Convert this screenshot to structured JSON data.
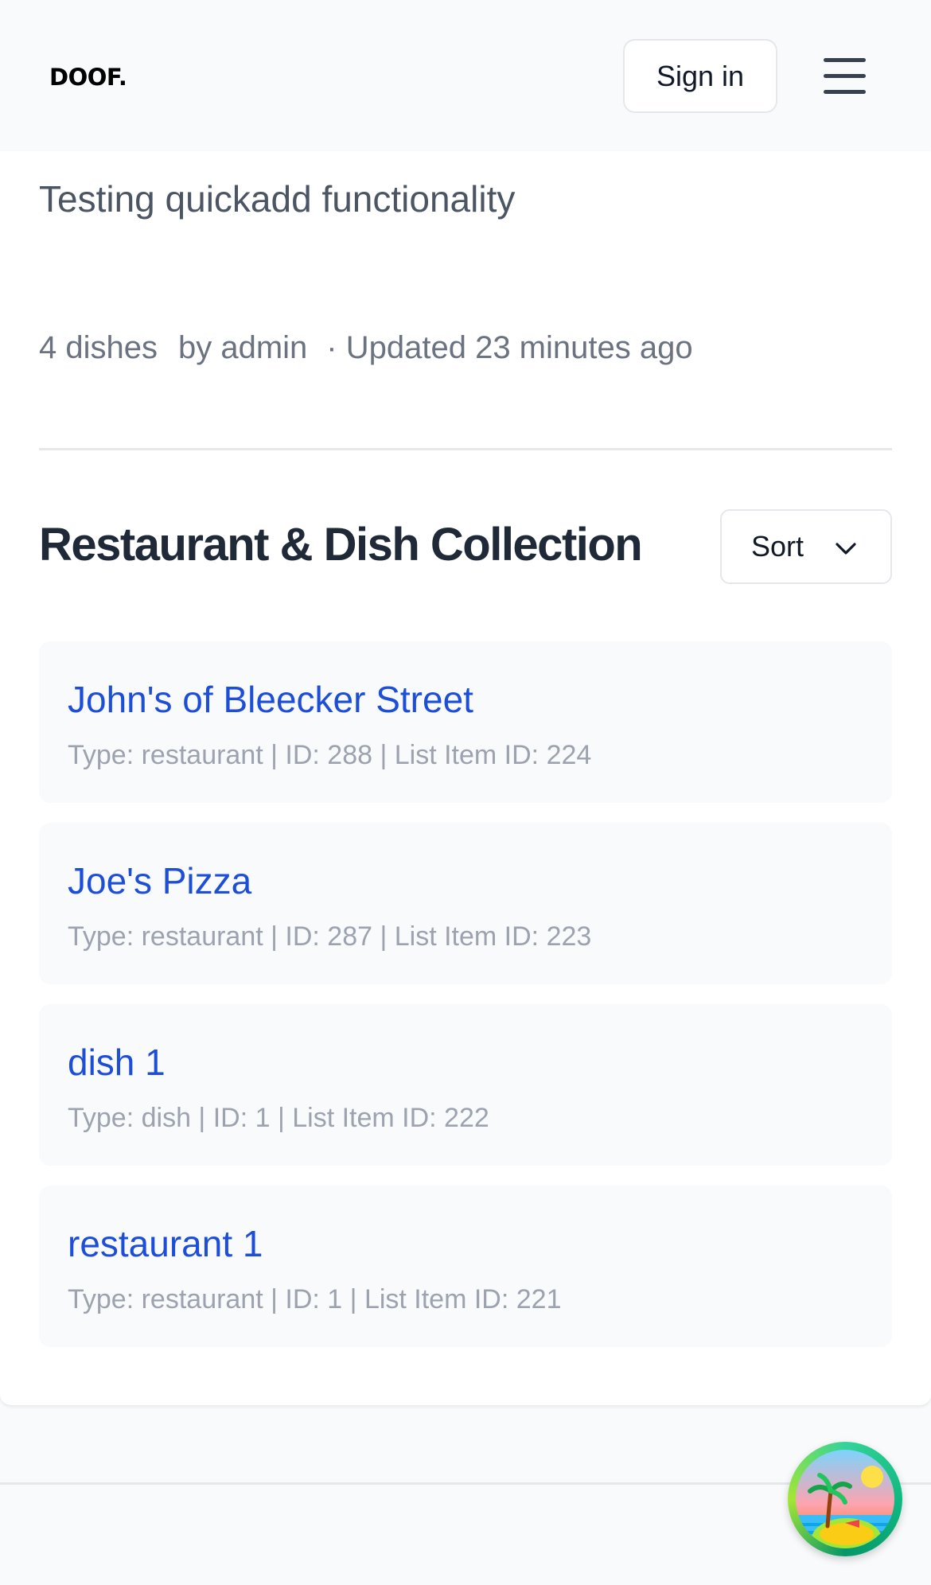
{
  "header": {
    "logo": "DOOF.",
    "sign_in_label": "Sign in"
  },
  "list": {
    "description": "Testing quickadd functionality",
    "dish_count": "4 dishes",
    "author": "by admin",
    "updated": "· Updated 23 minutes ago"
  },
  "collection": {
    "title": "Restaurant & Dish Collection",
    "sort_label": "Sort",
    "items": [
      {
        "title": "John's of Bleecker Street",
        "meta": "Type: restaurant | ID: 288 | List Item ID: 224"
      },
      {
        "title": "Joe's Pizza",
        "meta": "Type: restaurant | ID: 287 | List Item ID: 223"
      },
      {
        "title": "dish 1",
        "meta": "Type: dish | ID: 1 | List Item ID: 222"
      },
      {
        "title": "restaurant 1",
        "meta": "Type: restaurant | ID: 1 | List Item ID: 221"
      }
    ]
  },
  "colors": {
    "link": "#1d4ed8",
    "muted": "#6b7280",
    "light_muted": "#9ca3af",
    "card_bg": "#f9fafb",
    "border": "#e5e7eb"
  },
  "icons": {
    "menu": "hamburger-menu-icon",
    "sort_chevron": "chevron-down-icon",
    "avatar": "island-avatar-icon"
  }
}
